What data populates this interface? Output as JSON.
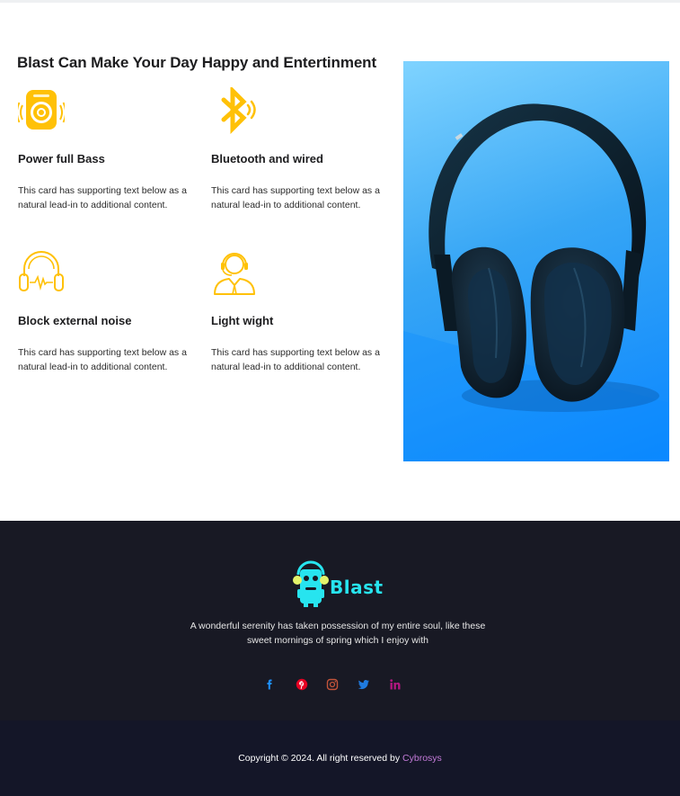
{
  "section": {
    "title": "Blast Can Make Your Day Happy and Entertinment"
  },
  "features": [
    {
      "icon": "speaker-icon",
      "title": "Power full Bass",
      "text": "This card has supporting text below as a natural lead-in to additional content."
    },
    {
      "icon": "bluetooth-icon",
      "title": "Bluetooth and wired",
      "text": "This card has supporting text below as a natural lead-in to additional content."
    },
    {
      "icon": "noise-cancelling-headphones-icon",
      "title": "Block external noise",
      "text": "This card has supporting text below as a natural lead-in to additional content."
    },
    {
      "icon": "headset-person-icon",
      "title": "Light wight",
      "text": "This card has supporting text below as a natural lead-in to additional content."
    }
  ],
  "hero_image": {
    "subject": "headphones-image"
  },
  "footer": {
    "logo_text": "Blast",
    "tagline": "A wonderful serenity has taken possession of my entire soul, like these sweet mornings of spring which I enjoy with",
    "socials": [
      {
        "icon": "facebook-icon",
        "color": "#1e90ff"
      },
      {
        "icon": "pinterest-icon",
        "color": "#e60023"
      },
      {
        "icon": "instagram-icon",
        "color": "#c2543a"
      },
      {
        "icon": "twitter-icon",
        "color": "#1f7be0"
      },
      {
        "icon": "linkedin-icon",
        "color": "#b0177f"
      }
    ],
    "copyright_prefix": "Copyright © 2024. All right reserved by ",
    "copyright_brand": "Cybrosys"
  },
  "colors": {
    "accent_yellow": "#ffc107",
    "footer_bg": "#181924",
    "logo_cyan": "#27e4ef",
    "brand_link": "#c47bd9"
  }
}
